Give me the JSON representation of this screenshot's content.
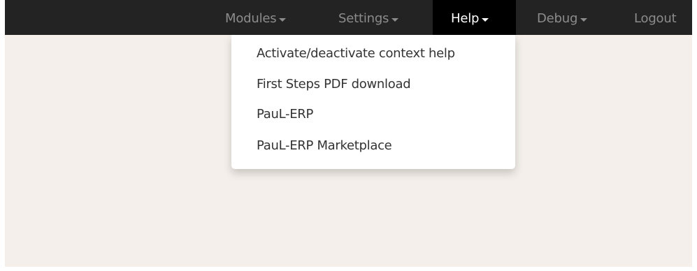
{
  "navbar": {
    "items": [
      {
        "label": "Modules"
      },
      {
        "label": "Settings"
      },
      {
        "label": "Help"
      },
      {
        "label": "Debug"
      },
      {
        "label": "Logout"
      }
    ]
  },
  "help_menu": {
    "items": [
      {
        "label": "Activate/deactivate context help"
      },
      {
        "label": "First Steps PDF download"
      },
      {
        "label": "PauL-ERP"
      },
      {
        "label": "PauL-ERP Marketplace"
      }
    ]
  },
  "colors": {
    "navbar_bg": "#232323",
    "active_bg": "#000000",
    "page_bg": "#f4efea",
    "nav_text": "#8c8c8c",
    "active_text": "#ffffff"
  }
}
